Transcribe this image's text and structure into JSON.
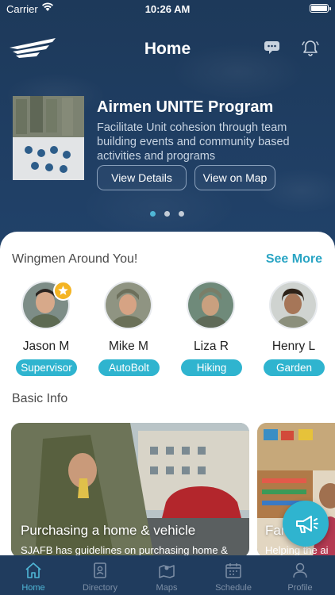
{
  "status_bar": {
    "carrier": "Carrier",
    "time": "10:26 AM"
  },
  "header": {
    "title": "Home",
    "logo": "wing-logo",
    "icons": [
      "chat-bubbles-icon",
      "bell-icon"
    ]
  },
  "promo": {
    "title": "Airmen UNITE Program",
    "description": "Facilitate Unit cohesion through team building events and community based activities and programs",
    "buttons": {
      "details": "View Details",
      "map": "View on Map"
    },
    "carousel": {
      "count": 3,
      "active_index": 0
    }
  },
  "wingmen": {
    "title": "Wingmen Around You!",
    "see_more": "See More",
    "people": [
      {
        "name": "Jason M",
        "tag": "Supervisor",
        "starred": true
      },
      {
        "name": "Mike M",
        "tag": "AutoBolt",
        "starred": false
      },
      {
        "name": "Liza R",
        "tag": "Hiking",
        "starred": false
      },
      {
        "name": "Henry L",
        "tag": "Garden",
        "starred": false
      }
    ]
  },
  "basic_info": {
    "title": "Basic Info",
    "cards": [
      {
        "title": "Purchasing a home & vehicle",
        "subtitle": "SJAFB has guidelines on purchasing home &"
      },
      {
        "title": "Family Su",
        "subtitle": "Helping the ai"
      }
    ]
  },
  "fab": {
    "icon": "megaphone-icon"
  },
  "tabs": [
    {
      "label": "Home",
      "icon": "home-icon",
      "active": true
    },
    {
      "label": "Directory",
      "icon": "directory-icon",
      "active": false
    },
    {
      "label": "Maps",
      "icon": "map-icon",
      "active": false
    },
    {
      "label": "Schedule",
      "icon": "calendar-icon",
      "active": false
    },
    {
      "label": "Profile",
      "icon": "profile-icon",
      "active": false
    }
  ],
  "colors": {
    "navy": "#1e3a5c",
    "accent": "#2fb4cf",
    "star": "#f4b423",
    "tab_inactive": "#7d8fa6"
  }
}
